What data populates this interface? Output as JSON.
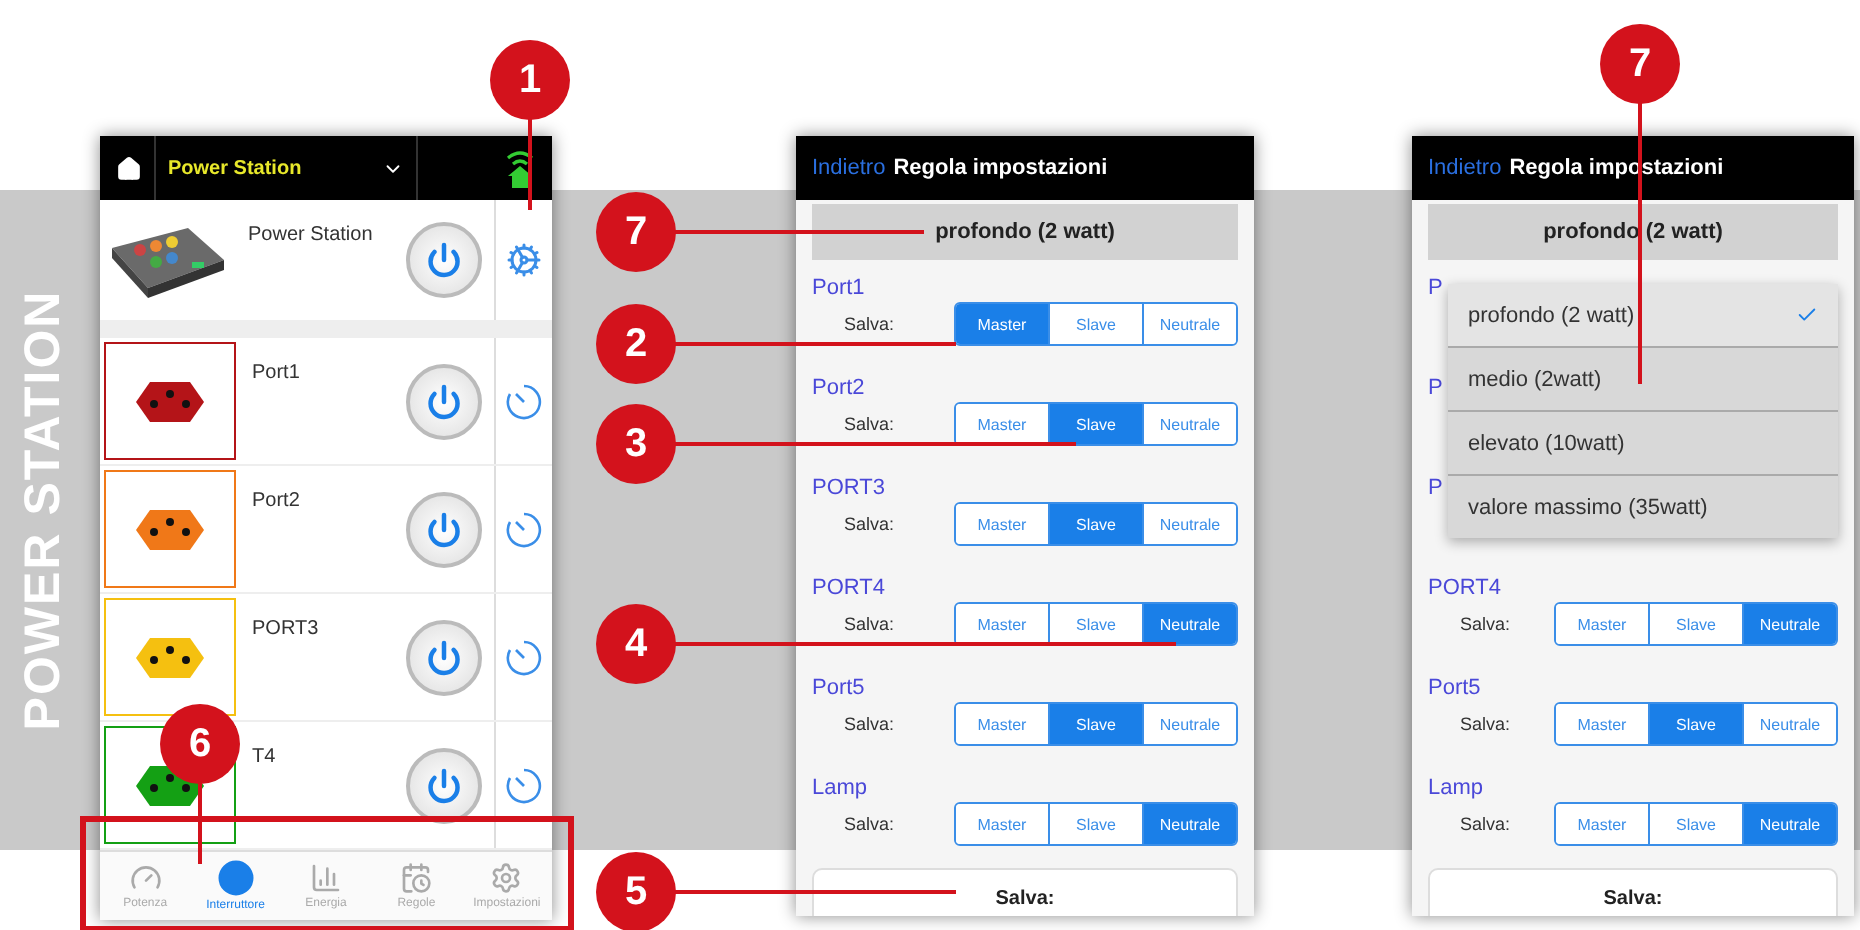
{
  "side_label": "POWER STATION",
  "devices_screen": {
    "header": {
      "title": "Power Station"
    },
    "devices": [
      {
        "kind": "station",
        "name": "Power Station"
      },
      {
        "kind": "socket",
        "name": "Port1",
        "color": "#b41418"
      },
      {
        "kind": "socket",
        "name": "Port2",
        "color": "#f07818"
      },
      {
        "kind": "socket",
        "name": "PORT3",
        "color": "#f5c010"
      },
      {
        "kind": "socket",
        "name": "T4",
        "color": "#14a014"
      }
    ],
    "tabs": [
      {
        "label": "Potenza",
        "selected": false
      },
      {
        "label": "Interruttore",
        "selected": true
      },
      {
        "label": "Energia",
        "selected": false
      },
      {
        "label": "Regole",
        "selected": false
      },
      {
        "label": "Impostazioni",
        "selected": false
      }
    ]
  },
  "settings_screens": [
    {
      "back": "Indietro",
      "title": "Regola impostazioni",
      "mode": "profondo (2 watt)",
      "ports": [
        {
          "name": "Port1",
          "label": "Salva:",
          "options": [
            {
              "label": "Master",
              "selected": true
            },
            {
              "label": "Slave",
              "selected": false
            },
            {
              "label": "Neutrale",
              "selected": false
            }
          ]
        },
        {
          "name": "Port2",
          "label": "Salva:",
          "options": [
            {
              "label": "Master",
              "selected": false
            },
            {
              "label": "Slave",
              "selected": true
            },
            {
              "label": "Neutrale",
              "selected": false
            }
          ]
        },
        {
          "name": "PORT3",
          "label": "Salva:",
          "options": [
            {
              "label": "Master",
              "selected": false
            },
            {
              "label": "Slave",
              "selected": true
            },
            {
              "label": "Neutrale",
              "selected": false
            }
          ]
        },
        {
          "name": "PORT4",
          "label": "Salva:",
          "options": [
            {
              "label": "Master",
              "selected": false
            },
            {
              "label": "Slave",
              "selected": false
            },
            {
              "label": "Neutrale",
              "selected": true
            }
          ]
        },
        {
          "name": "Port5",
          "label": "Salva:",
          "options": [
            {
              "label": "Master",
              "selected": false
            },
            {
              "label": "Slave",
              "selected": true
            },
            {
              "label": "Neutrale",
              "selected": false
            }
          ]
        },
        {
          "name": "Lamp",
          "label": "Salva:",
          "options": [
            {
              "label": "Master",
              "selected": false
            },
            {
              "label": "Slave",
              "selected": false
            },
            {
              "label": "Neutrale",
              "selected": true
            }
          ]
        }
      ],
      "save": "Salva:"
    },
    {
      "back": "Indietro",
      "title": "Regola impostazioni",
      "mode": "profondo (2 watt)",
      "ports": [
        {
          "name": "P"
        },
        {
          "name": "P"
        },
        {
          "name": "P"
        },
        {
          "name": "PORT4",
          "label": "Salva:",
          "options": [
            {
              "label": "Master",
              "selected": false
            },
            {
              "label": "Slave",
              "selected": false
            },
            {
              "label": "Neutrale",
              "selected": true
            }
          ]
        },
        {
          "name": "Port5",
          "label": "Salva:",
          "options": [
            {
              "label": "Master",
              "selected": false
            },
            {
              "label": "Slave",
              "selected": true
            },
            {
              "label": "Neutrale",
              "selected": false
            }
          ]
        },
        {
          "name": "Lamp",
          "label": "Salva:",
          "options": [
            {
              "label": "Master",
              "selected": false
            },
            {
              "label": "Slave",
              "selected": false
            },
            {
              "label": "Neutrale",
              "selected": true
            }
          ]
        }
      ],
      "dropdown": [
        {
          "label": "profondo (2 watt)",
          "selected": true
        },
        {
          "label": "medio (2watt)",
          "selected": false
        },
        {
          "label": "elevato (10watt)",
          "selected": false
        },
        {
          "label": "valore massimo (35watt)",
          "selected": false
        }
      ],
      "save": "Salva:"
    }
  ],
  "callouts": [
    {
      "number": "1"
    },
    {
      "number": "7"
    },
    {
      "number": "2"
    },
    {
      "number": "3"
    },
    {
      "number": "4"
    },
    {
      "number": "5"
    },
    {
      "number": "6"
    },
    {
      "number": "7"
    }
  ]
}
